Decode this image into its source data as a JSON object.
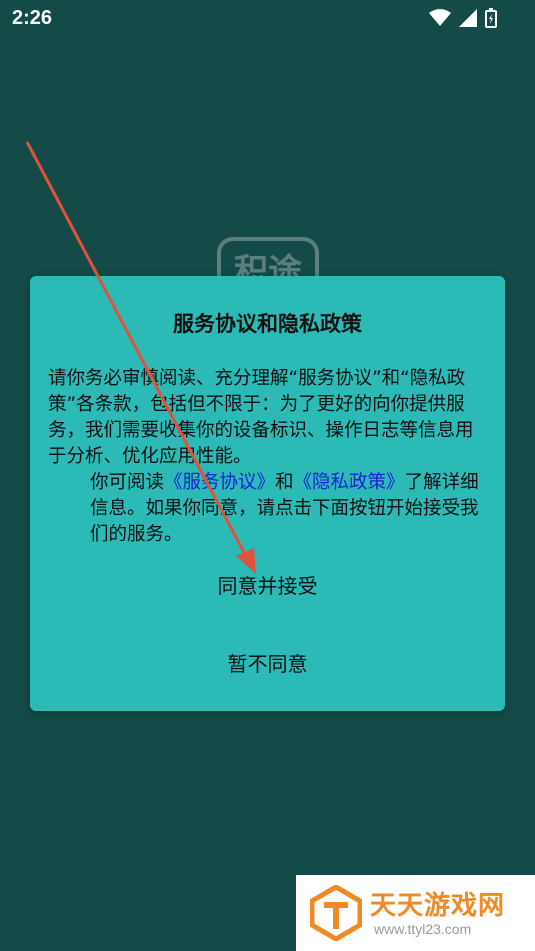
{
  "status_bar": {
    "time": "2:26",
    "icons": [
      "wifi-icon",
      "signal-icon",
      "battery-icon"
    ]
  },
  "background_logo": {
    "text": "积途"
  },
  "dialog": {
    "title": "服务协议和隐私政策",
    "paragraph1": "请你务必审慎阅读、充分理解“服务协议”和“隐私政策”各条款，包括但不限于：为了更好的向你提供服务，我们需要收集你的设备标识、操作日志等信息用于分析、优化应用性能。",
    "paragraph2_prefix": "你可阅读",
    "link_service": "《服务协议》",
    "and": "和",
    "link_privacy": "《隐私政策》",
    "paragraph2_suffix": "了解详细信息。如果你同意，请点击下面按钮开始接受我们的服务。",
    "agree_button": "同意并接受",
    "decline_button": "暂不同意"
  },
  "watermark": {
    "title": "天天游戏网",
    "url": "www.ttyl23.com"
  },
  "colors": {
    "background": "#144a47",
    "dialog": "#2bbab5",
    "link": "#1a22d6",
    "annotation_arrow": "#e0523a",
    "watermark_accent": "#f08a24"
  }
}
